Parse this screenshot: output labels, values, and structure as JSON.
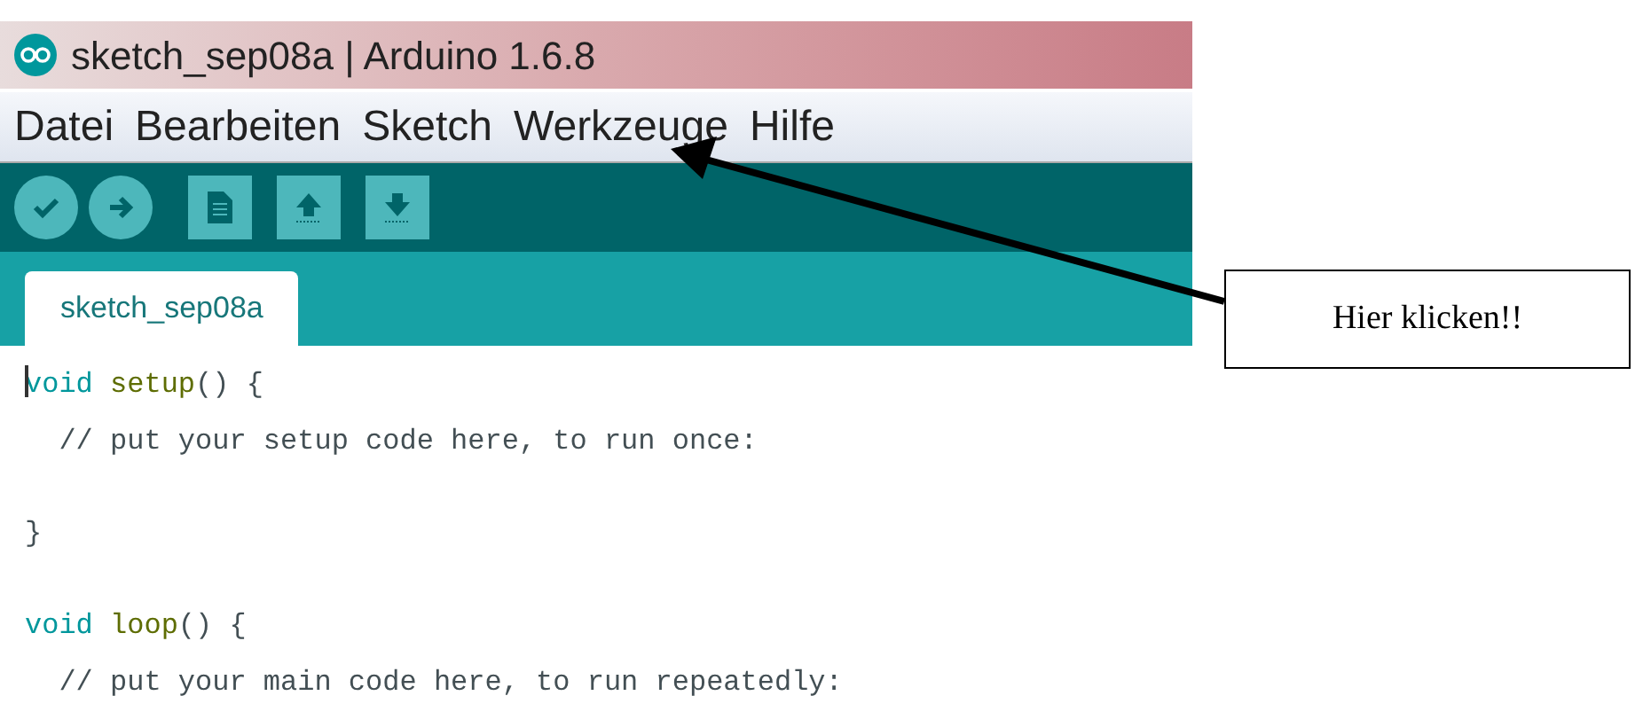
{
  "window": {
    "title": "sketch_sep08a | Arduino 1.6.8"
  },
  "menu": [
    "Datei",
    "Bearbeiten",
    "Sketch",
    "Werkzeuge",
    "Hilfe"
  ],
  "tabs": [
    {
      "label": "sketch_sep08a",
      "selected": true
    }
  ],
  "editor": {
    "blocks": [
      [
        {
          "tokens": [
            {
              "kind": "keyword",
              "text": "void "
            },
            {
              "kind": "function",
              "text": "setup"
            },
            {
              "kind": "punct",
              "text": "() {"
            }
          ]
        },
        {
          "tokens": [
            {
              "kind": "comment",
              "text": "  // put your setup code here, to run once:"
            }
          ]
        }
      ],
      [
        {
          "tokens": [
            {
              "kind": "punct",
              "text": "}"
            }
          ]
        }
      ],
      [
        {
          "tokens": [
            {
              "kind": "keyword",
              "text": "void "
            },
            {
              "kind": "function",
              "text": "loop"
            },
            {
              "kind": "punct",
              "text": "() {"
            }
          ]
        },
        {
          "tokens": [
            {
              "kind": "comment",
              "text": "  // put your main code here, to run repeatedly:"
            }
          ]
        }
      ]
    ]
  },
  "callout": {
    "text": "Hier klicken!!"
  }
}
